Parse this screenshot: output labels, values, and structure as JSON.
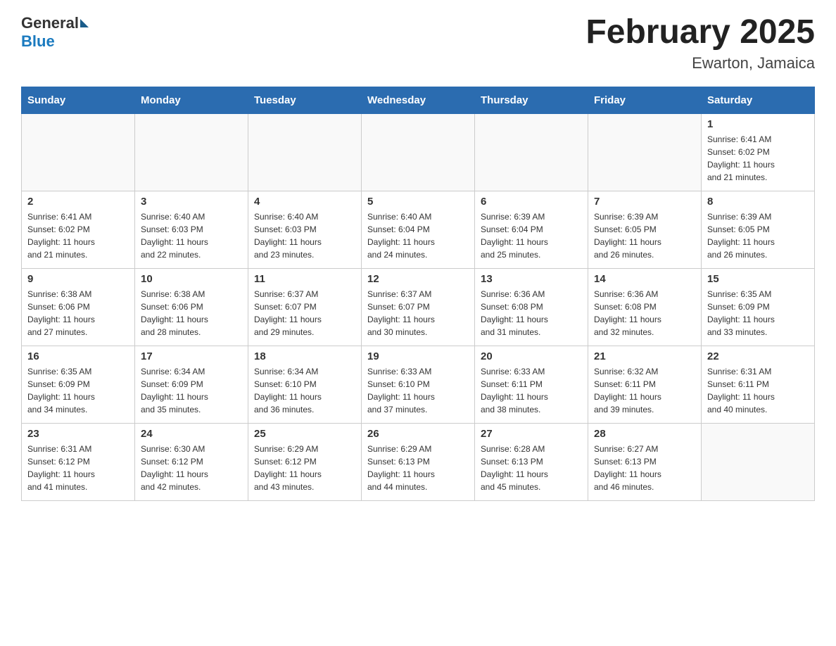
{
  "header": {
    "logo_general": "General",
    "logo_blue": "Blue",
    "month_title": "February 2025",
    "location": "Ewarton, Jamaica"
  },
  "days_of_week": [
    "Sunday",
    "Monday",
    "Tuesday",
    "Wednesday",
    "Thursday",
    "Friday",
    "Saturday"
  ],
  "weeks": [
    [
      {
        "day": "",
        "info": ""
      },
      {
        "day": "",
        "info": ""
      },
      {
        "day": "",
        "info": ""
      },
      {
        "day": "",
        "info": ""
      },
      {
        "day": "",
        "info": ""
      },
      {
        "day": "",
        "info": ""
      },
      {
        "day": "1",
        "info": "Sunrise: 6:41 AM\nSunset: 6:02 PM\nDaylight: 11 hours\nand 21 minutes."
      }
    ],
    [
      {
        "day": "2",
        "info": "Sunrise: 6:41 AM\nSunset: 6:02 PM\nDaylight: 11 hours\nand 21 minutes."
      },
      {
        "day": "3",
        "info": "Sunrise: 6:40 AM\nSunset: 6:03 PM\nDaylight: 11 hours\nand 22 minutes."
      },
      {
        "day": "4",
        "info": "Sunrise: 6:40 AM\nSunset: 6:03 PM\nDaylight: 11 hours\nand 23 minutes."
      },
      {
        "day": "5",
        "info": "Sunrise: 6:40 AM\nSunset: 6:04 PM\nDaylight: 11 hours\nand 24 minutes."
      },
      {
        "day": "6",
        "info": "Sunrise: 6:39 AM\nSunset: 6:04 PM\nDaylight: 11 hours\nand 25 minutes."
      },
      {
        "day": "7",
        "info": "Sunrise: 6:39 AM\nSunset: 6:05 PM\nDaylight: 11 hours\nand 26 minutes."
      },
      {
        "day": "8",
        "info": "Sunrise: 6:39 AM\nSunset: 6:05 PM\nDaylight: 11 hours\nand 26 minutes."
      }
    ],
    [
      {
        "day": "9",
        "info": "Sunrise: 6:38 AM\nSunset: 6:06 PM\nDaylight: 11 hours\nand 27 minutes."
      },
      {
        "day": "10",
        "info": "Sunrise: 6:38 AM\nSunset: 6:06 PM\nDaylight: 11 hours\nand 28 minutes."
      },
      {
        "day": "11",
        "info": "Sunrise: 6:37 AM\nSunset: 6:07 PM\nDaylight: 11 hours\nand 29 minutes."
      },
      {
        "day": "12",
        "info": "Sunrise: 6:37 AM\nSunset: 6:07 PM\nDaylight: 11 hours\nand 30 minutes."
      },
      {
        "day": "13",
        "info": "Sunrise: 6:36 AM\nSunset: 6:08 PM\nDaylight: 11 hours\nand 31 minutes."
      },
      {
        "day": "14",
        "info": "Sunrise: 6:36 AM\nSunset: 6:08 PM\nDaylight: 11 hours\nand 32 minutes."
      },
      {
        "day": "15",
        "info": "Sunrise: 6:35 AM\nSunset: 6:09 PM\nDaylight: 11 hours\nand 33 minutes."
      }
    ],
    [
      {
        "day": "16",
        "info": "Sunrise: 6:35 AM\nSunset: 6:09 PM\nDaylight: 11 hours\nand 34 minutes."
      },
      {
        "day": "17",
        "info": "Sunrise: 6:34 AM\nSunset: 6:09 PM\nDaylight: 11 hours\nand 35 minutes."
      },
      {
        "day": "18",
        "info": "Sunrise: 6:34 AM\nSunset: 6:10 PM\nDaylight: 11 hours\nand 36 minutes."
      },
      {
        "day": "19",
        "info": "Sunrise: 6:33 AM\nSunset: 6:10 PM\nDaylight: 11 hours\nand 37 minutes."
      },
      {
        "day": "20",
        "info": "Sunrise: 6:33 AM\nSunset: 6:11 PM\nDaylight: 11 hours\nand 38 minutes."
      },
      {
        "day": "21",
        "info": "Sunrise: 6:32 AM\nSunset: 6:11 PM\nDaylight: 11 hours\nand 39 minutes."
      },
      {
        "day": "22",
        "info": "Sunrise: 6:31 AM\nSunset: 6:11 PM\nDaylight: 11 hours\nand 40 minutes."
      }
    ],
    [
      {
        "day": "23",
        "info": "Sunrise: 6:31 AM\nSunset: 6:12 PM\nDaylight: 11 hours\nand 41 minutes."
      },
      {
        "day": "24",
        "info": "Sunrise: 6:30 AM\nSunset: 6:12 PM\nDaylight: 11 hours\nand 42 minutes."
      },
      {
        "day": "25",
        "info": "Sunrise: 6:29 AM\nSunset: 6:12 PM\nDaylight: 11 hours\nand 43 minutes."
      },
      {
        "day": "26",
        "info": "Sunrise: 6:29 AM\nSunset: 6:13 PM\nDaylight: 11 hours\nand 44 minutes."
      },
      {
        "day": "27",
        "info": "Sunrise: 6:28 AM\nSunset: 6:13 PM\nDaylight: 11 hours\nand 45 minutes."
      },
      {
        "day": "28",
        "info": "Sunrise: 6:27 AM\nSunset: 6:13 PM\nDaylight: 11 hours\nand 46 minutes."
      },
      {
        "day": "",
        "info": ""
      }
    ]
  ],
  "colors": {
    "header_bg": "#2b6cb0",
    "header_text": "#ffffff",
    "accent": "#1a7abf"
  }
}
